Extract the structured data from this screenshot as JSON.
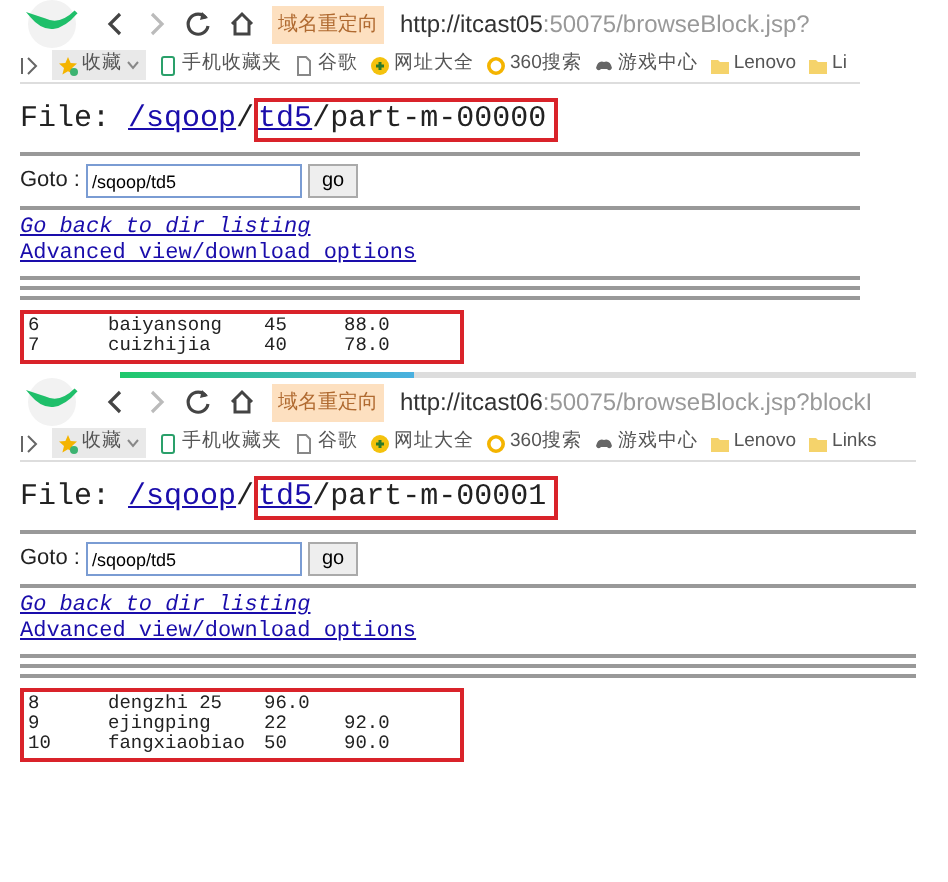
{
  "windows": [
    {
      "redirect_badge": "域名重定向",
      "url_host": "http://itcast05",
      "url_rest": ":50075/browseBlock.jsp?",
      "bookmarks": [
        {
          "kind": "star",
          "label": "收藏",
          "caret": true
        },
        {
          "kind": "phone",
          "label": "手机收藏夹"
        },
        {
          "kind": "doc",
          "label": "谷歌"
        },
        {
          "kind": "globe",
          "label": "网址大全"
        },
        {
          "kind": "ring",
          "label": "360搜索"
        },
        {
          "kind": "game",
          "label": "游戏中心"
        },
        {
          "kind": "folder",
          "label": "Lenovo"
        },
        {
          "kind": "folder",
          "label": "Li"
        }
      ],
      "file_label": "File:",
      "path_link": "/sqoop",
      "sep": "/",
      "dir_link": "td5",
      "file_name": "/part-m-00000",
      "goto_label": "Goto :",
      "goto_value": "/sqoop/td5",
      "go_button": "go",
      "links": [
        "Go back to dir listing",
        "Advanced view/download options"
      ],
      "rows": [
        [
          "6",
          "baiyansong",
          "45",
          "88.0"
        ],
        [
          "7",
          "cuizhijia",
          "40",
          "78.0"
        ]
      ]
    },
    {
      "loading": {
        "level": 0.37
      },
      "redirect_badge": "域名重定向",
      "url_host": "http://itcast06",
      "url_rest": ":50075/browseBlock.jsp?blockI",
      "bookmarks": [
        {
          "kind": "star",
          "label": "收藏",
          "caret": true
        },
        {
          "kind": "phone",
          "label": "手机收藏夹"
        },
        {
          "kind": "doc",
          "label": "谷歌"
        },
        {
          "kind": "globe",
          "label": "网址大全"
        },
        {
          "kind": "ring",
          "label": "360搜索"
        },
        {
          "kind": "game",
          "label": "游戏中心"
        },
        {
          "kind": "folder",
          "label": "Lenovo"
        },
        {
          "kind": "folder",
          "label": "Links"
        }
      ],
      "file_label": "File:",
      "path_link": "/sqoop",
      "sep": "/",
      "dir_link": "td5",
      "file_name": "/part-m-00001",
      "goto_label": "Goto :",
      "goto_value": "/sqoop/td5",
      "go_button": "go",
      "links": [
        "Go back to dir listing",
        "Advanced view/download options"
      ],
      "rows": [
        [
          "8",
          "dengzhi 25",
          "96.0"
        ],
        [
          "9",
          "ejingping",
          "22",
          "92.0"
        ],
        [
          "10",
          "fangxiaobiao",
          "50",
          "90.0"
        ]
      ]
    }
  ]
}
